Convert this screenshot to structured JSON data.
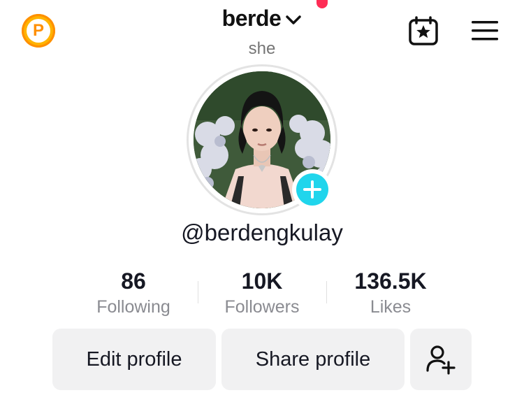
{
  "header": {
    "title": "berde",
    "pronoun": "she",
    "coin_letter": "P"
  },
  "profile": {
    "handle": "@berdengkulay"
  },
  "stats": [
    {
      "value": "86",
      "label": "Following"
    },
    {
      "value": "10K",
      "label": "Followers"
    },
    {
      "value": "136.5K",
      "label": "Likes"
    }
  ],
  "actions": {
    "edit_label": "Edit profile",
    "share_label": "Share profile"
  },
  "icons": {
    "coin": "coin-icon",
    "chevron": "chevron-down-icon",
    "calendar": "calendar-star-icon",
    "menu": "hamburger-menu-icon",
    "add": "plus-icon",
    "add_friend": "add-user-icon"
  },
  "colors": {
    "notification_dot": "#fe2c55",
    "add_badge": "#20d5ec",
    "coin": "#ffb300",
    "button_bg": "#f1f1f2"
  }
}
